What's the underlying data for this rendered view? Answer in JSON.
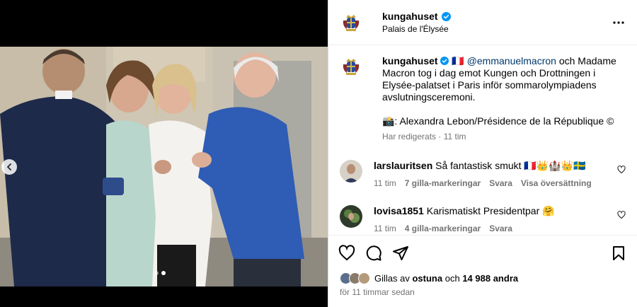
{
  "header": {
    "username": "kungahuset",
    "location": "Palais de l'Élysée"
  },
  "caption": {
    "username": "kungahuset",
    "flag": "🇫🇷",
    "mention": "@emmanuelmacron",
    "text": " och Madame Macron tog i dag emot Kungen och Drottningen i Elysée-palatset i Paris inför sommarolympiadens avslutningsceremoni.",
    "credit": "📸: Alexandra Lebon/Présidence de la République ©",
    "edited": "Har redigerats",
    "age": "11 tim"
  },
  "comments": [
    {
      "username": "larslauritsen",
      "text": "Så fantastisk smukt 🇫🇷👑🏰👑🇸🇪",
      "age": "11 tim",
      "likes": "7 gilla-markeringar",
      "reply": "Svara",
      "translate": "Visa översättning"
    },
    {
      "username": "lovisa1851",
      "text": "Karismatiskt Presidentpar 🤗",
      "age": "11 tim",
      "likes": "4 gilla-markeringar",
      "reply": "Svara"
    }
  ],
  "likes": {
    "prefix": "Gillas av",
    "user": "ostuna",
    "and": "och",
    "count": "14 988 andra"
  },
  "timestamp": "för 11 timmar sedan",
  "colors": {
    "verified": "#0095f6",
    "mention": "#00376b",
    "meta": "#737373"
  },
  "icons": [
    "royal-crest-icon",
    "verified-icon",
    "more-icon",
    "heart-icon",
    "comment-icon",
    "share-icon",
    "save-icon",
    "chevron-left-icon"
  ]
}
